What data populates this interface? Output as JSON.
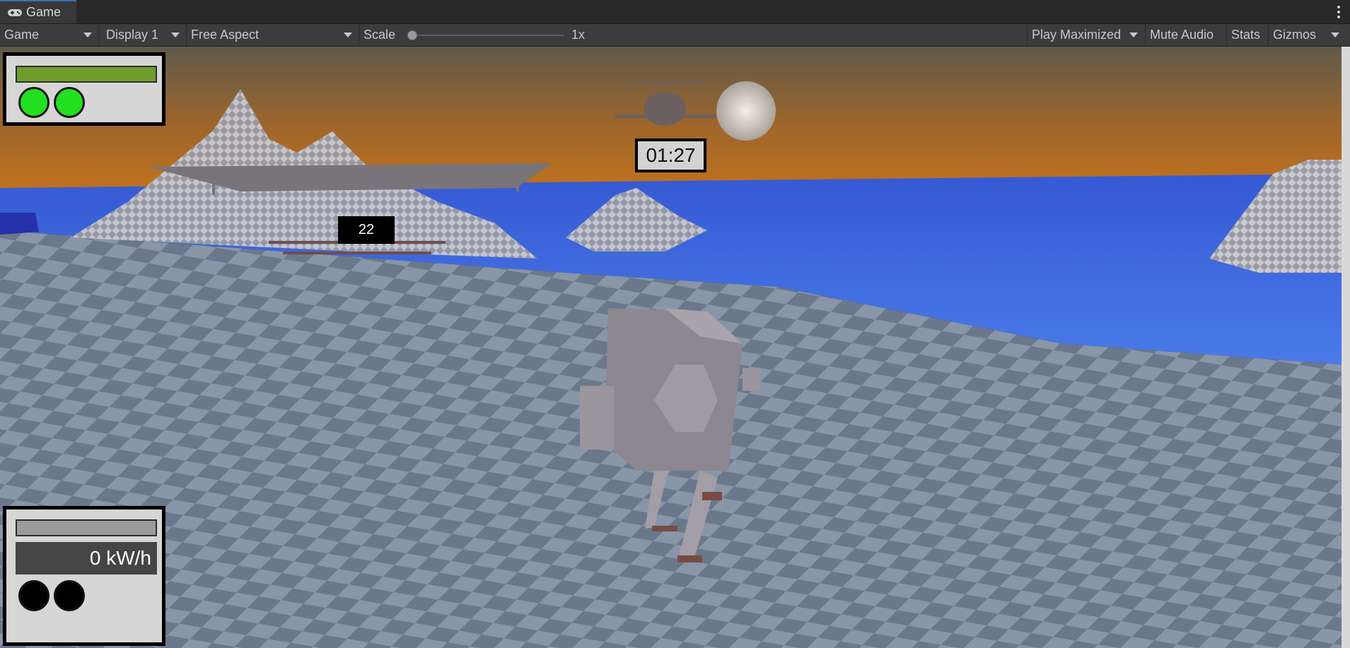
{
  "window": {
    "tab_title": "Game",
    "tab_icon": "gamepad-icon"
  },
  "toolbar": {
    "view_mode": "Game",
    "display": "Display 1",
    "aspect": "Free Aspect",
    "scale_label": "Scale",
    "scale_value": "1x",
    "scale_slider_fraction": 0.0,
    "play_mode": "Play Maximized",
    "mute": "Mute Audio",
    "stats": "Stats",
    "gizmos": "Gizmos"
  },
  "hud": {
    "top_left": {
      "health_fill_fraction": 1.0,
      "lights": [
        "on",
        "on"
      ]
    },
    "timer": "01:27",
    "counter": "22",
    "bottom_left": {
      "bar_fill_fraction": 0.0,
      "energy": "0 kW/h",
      "lights": [
        "off",
        "off"
      ]
    }
  },
  "colors": {
    "sky_top": "#5f5a4a",
    "sky_horizon": "#c4721c",
    "water": "#3f6fe0",
    "checker_light": "#8a96a6",
    "checker_dark": "#6c7a8c",
    "hud_green": "#22e01f",
    "health_bar": "#6f9e2c"
  }
}
